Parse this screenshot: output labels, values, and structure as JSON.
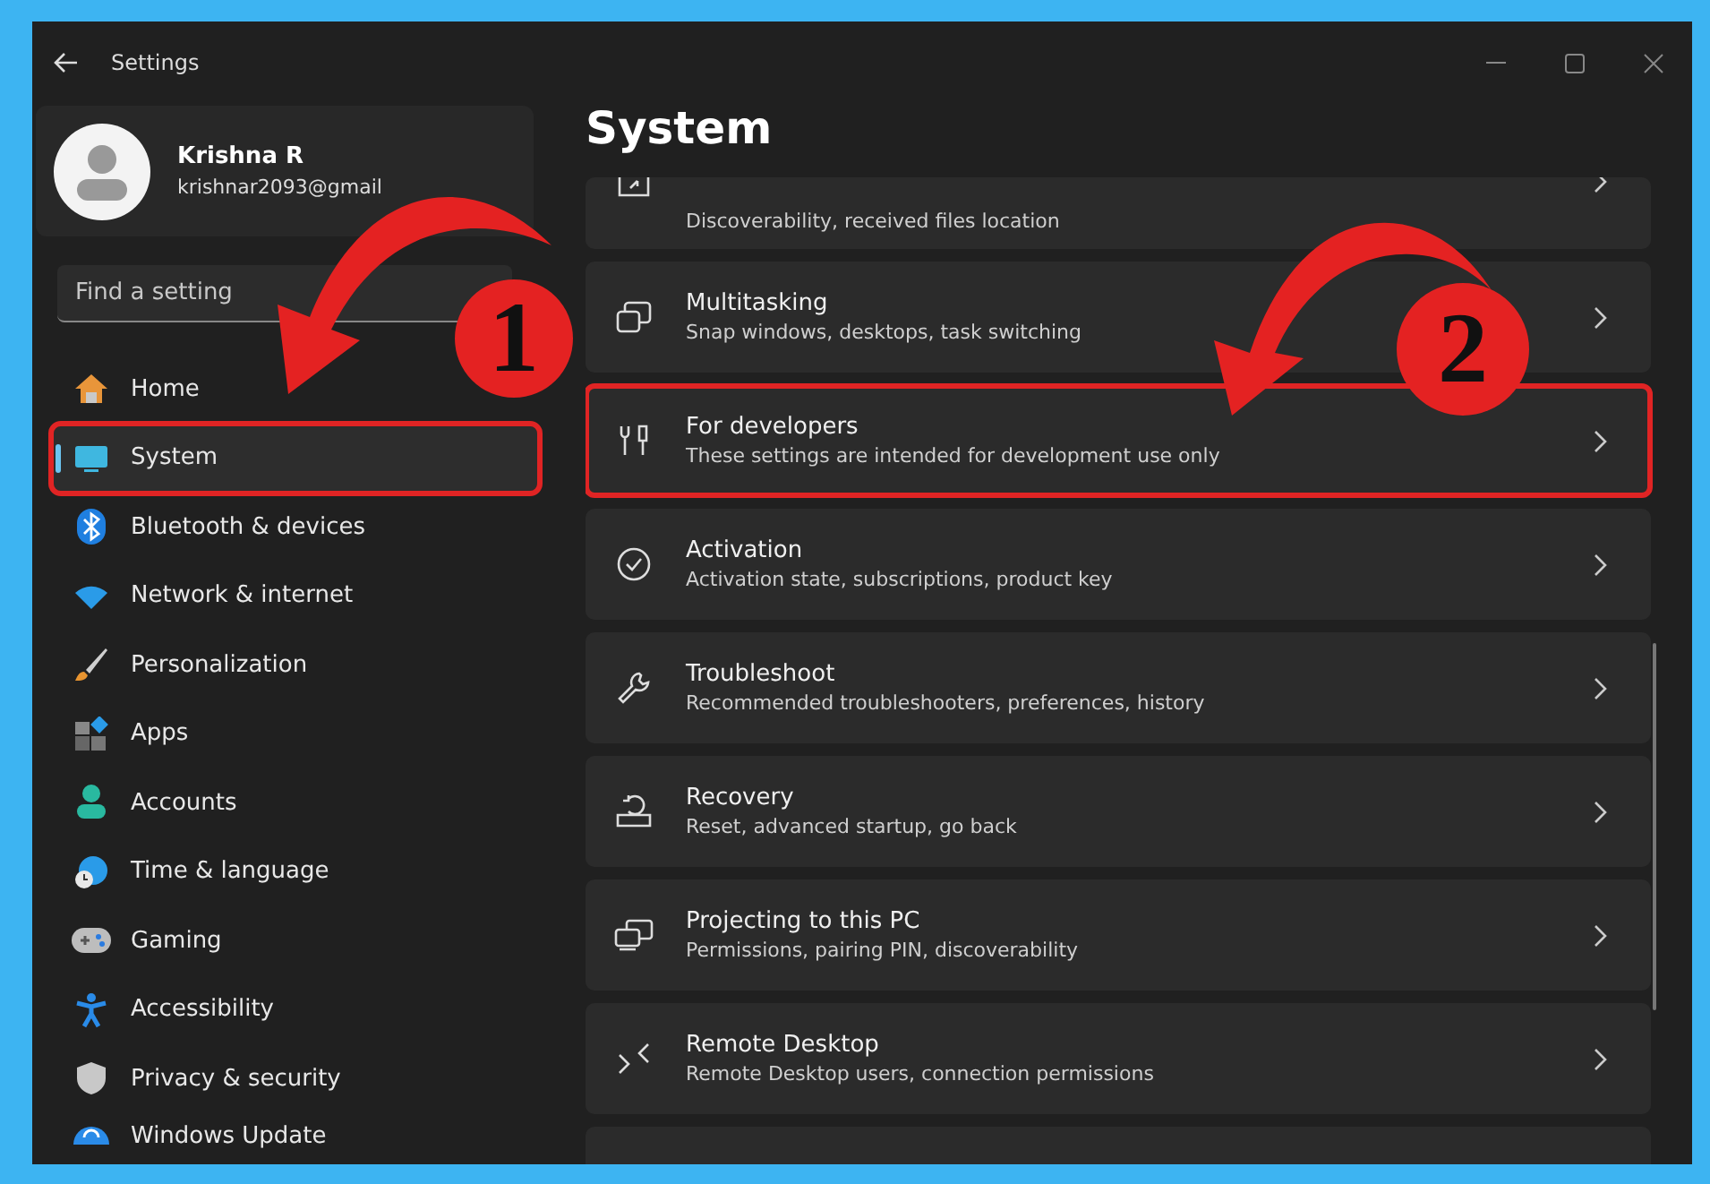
{
  "window": {
    "title": "Settings"
  },
  "profile": {
    "name": "Krishna R",
    "email": "krishnar2093@gmail"
  },
  "search": {
    "placeholder": "Find a setting"
  },
  "sidebar": {
    "items": [
      {
        "label": "Home",
        "selected": false,
        "highlighted": false
      },
      {
        "label": "System",
        "selected": true,
        "highlighted": true
      },
      {
        "label": "Bluetooth & devices",
        "selected": false,
        "highlighted": false
      },
      {
        "label": "Network & internet",
        "selected": false,
        "highlighted": false
      },
      {
        "label": "Personalization",
        "selected": false,
        "highlighted": false
      },
      {
        "label": "Apps",
        "selected": false,
        "highlighted": false
      },
      {
        "label": "Accounts",
        "selected": false,
        "highlighted": false
      },
      {
        "label": "Time & language",
        "selected": false,
        "highlighted": false
      },
      {
        "label": "Gaming",
        "selected": false,
        "highlighted": false
      },
      {
        "label": "Accessibility",
        "selected": false,
        "highlighted": false
      },
      {
        "label": "Privacy & security",
        "selected": false,
        "highlighted": false
      },
      {
        "label": "Windows Update",
        "selected": false,
        "highlighted": false,
        "kind": "cut"
      }
    ]
  },
  "page": {
    "title": "System"
  },
  "cards": [
    {
      "kind": "cut",
      "description": "Discoverability, received files location",
      "highlighted": false
    },
    {
      "kind": "full",
      "title": "Multitasking",
      "description": "Snap windows, desktops, task switching",
      "highlighted": false
    },
    {
      "kind": "full",
      "title": "For developers",
      "description": "These settings are intended for development use only",
      "highlighted": true
    },
    {
      "kind": "full",
      "title": "Activation",
      "description": "Activation state, subscriptions, product key",
      "highlighted": false
    },
    {
      "kind": "full",
      "title": "Troubleshoot",
      "description": "Recommended troubleshooters, preferences, history",
      "highlighted": false
    },
    {
      "kind": "full",
      "title": "Recovery",
      "description": "Reset, advanced startup, go back",
      "highlighted": false
    },
    {
      "kind": "full",
      "title": "Projecting to this PC",
      "description": "Permissions, pairing PIN, discoverability",
      "highlighted": false
    },
    {
      "kind": "full",
      "title": "Remote Desktop",
      "description": "Remote Desktop users, connection permissions",
      "highlighted": false
    },
    {
      "kind": "empty",
      "highlighted": false
    }
  ],
  "annotations": [
    {
      "label": "1"
    },
    {
      "label": "2"
    }
  ]
}
